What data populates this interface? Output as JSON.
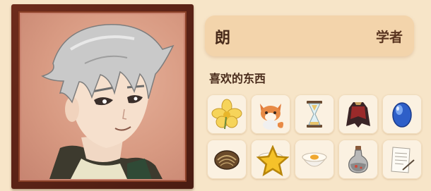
{
  "character": {
    "name": "朗",
    "title": "学者"
  },
  "favorites": {
    "heading": "喜欢的东西",
    "items": [
      {
        "icon": "yellow-flower-icon"
      },
      {
        "icon": "fox-plush-icon"
      },
      {
        "icon": "hourglass-icon"
      },
      {
        "icon": "red-cape-icon"
      },
      {
        "icon": "blue-gem-icon"
      },
      {
        "icon": "fossil-icon"
      },
      {
        "icon": "egg-custard-bowl-icon",
        "starred": true
      },
      {
        "icon": "egg-custard-bowl-icon"
      },
      {
        "icon": "potion-bottle-icon"
      },
      {
        "icon": "paper-quill-icon"
      }
    ]
  },
  "colors": {
    "frame": "#5a2216",
    "portrait_bg": "#d89a82",
    "name_bar": "#f3d4ab",
    "panel_bg": "#f7e5c8",
    "text_dark": "#4a2c1c"
  }
}
